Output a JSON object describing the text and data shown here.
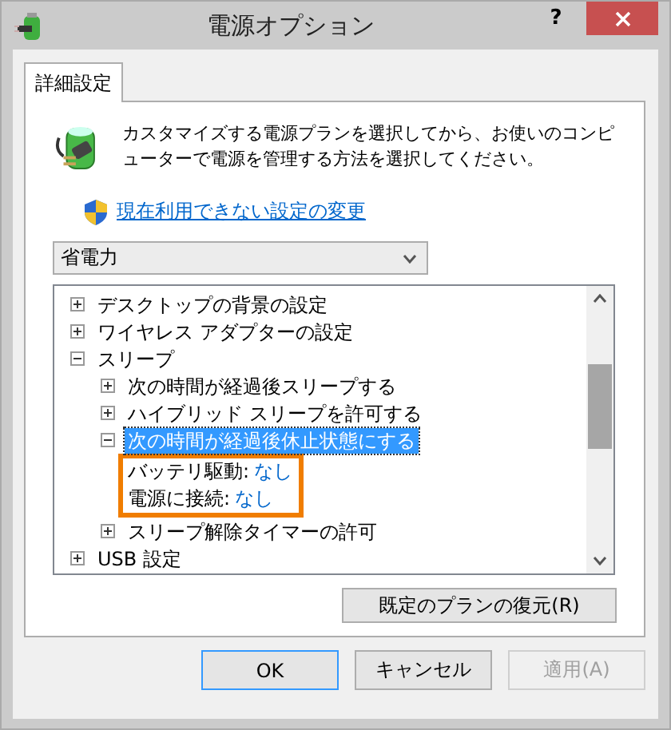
{
  "window": {
    "title": "電源オプション",
    "help": "?"
  },
  "tabs": [
    {
      "label": "詳細設定",
      "selected": true
    }
  ],
  "description": "カスタマイズする電源プランを選択してから、お使いのコンピューターで電源を管理する方法を選択してください。",
  "link": "現在利用できない設定の変更",
  "plan_dropdown": {
    "value": "省電力"
  },
  "tree": [
    {
      "label": "デスクトップの背景の設定",
      "kind": "setting",
      "expanded": false,
      "selected": false
    },
    {
      "label": "ワイヤレス アダプターの設定",
      "kind": "setting",
      "expanded": false,
      "selected": false
    },
    {
      "label": "スリープ",
      "kind": "setting",
      "expanded": true,
      "selected": false,
      "children": [
        {
          "label": "次の時間が経過後スリープする",
          "kind": "setting",
          "expanded": false,
          "selected": false
        },
        {
          "label": "ハイブリッド スリープを許可する",
          "kind": "setting",
          "expanded": false,
          "selected": false
        },
        {
          "label": "次の時間が経過後休止状態にする",
          "kind": "setting",
          "expanded": true,
          "selected": true,
          "highlighted": true,
          "children": [
            {
              "label": "バッテリ駆動:",
              "value": "なし",
              "kind": "value"
            },
            {
              "label": "電源に接続:",
              "value": "なし",
              "kind": "value"
            }
          ]
        },
        {
          "label": "スリープ解除タイマーの許可",
          "kind": "setting",
          "expanded": false,
          "selected": false
        }
      ]
    },
    {
      "label": "USB 設定",
      "kind": "setting",
      "expanded": false,
      "selected": false
    }
  ],
  "restore_button": "既定のプランの復元(R)",
  "buttons": [
    {
      "label": "OK",
      "disabled": false,
      "default": true
    },
    {
      "label": "キャンセル",
      "disabled": false,
      "default": false
    },
    {
      "label": "適用(A)",
      "disabled": true,
      "default": false
    }
  ]
}
